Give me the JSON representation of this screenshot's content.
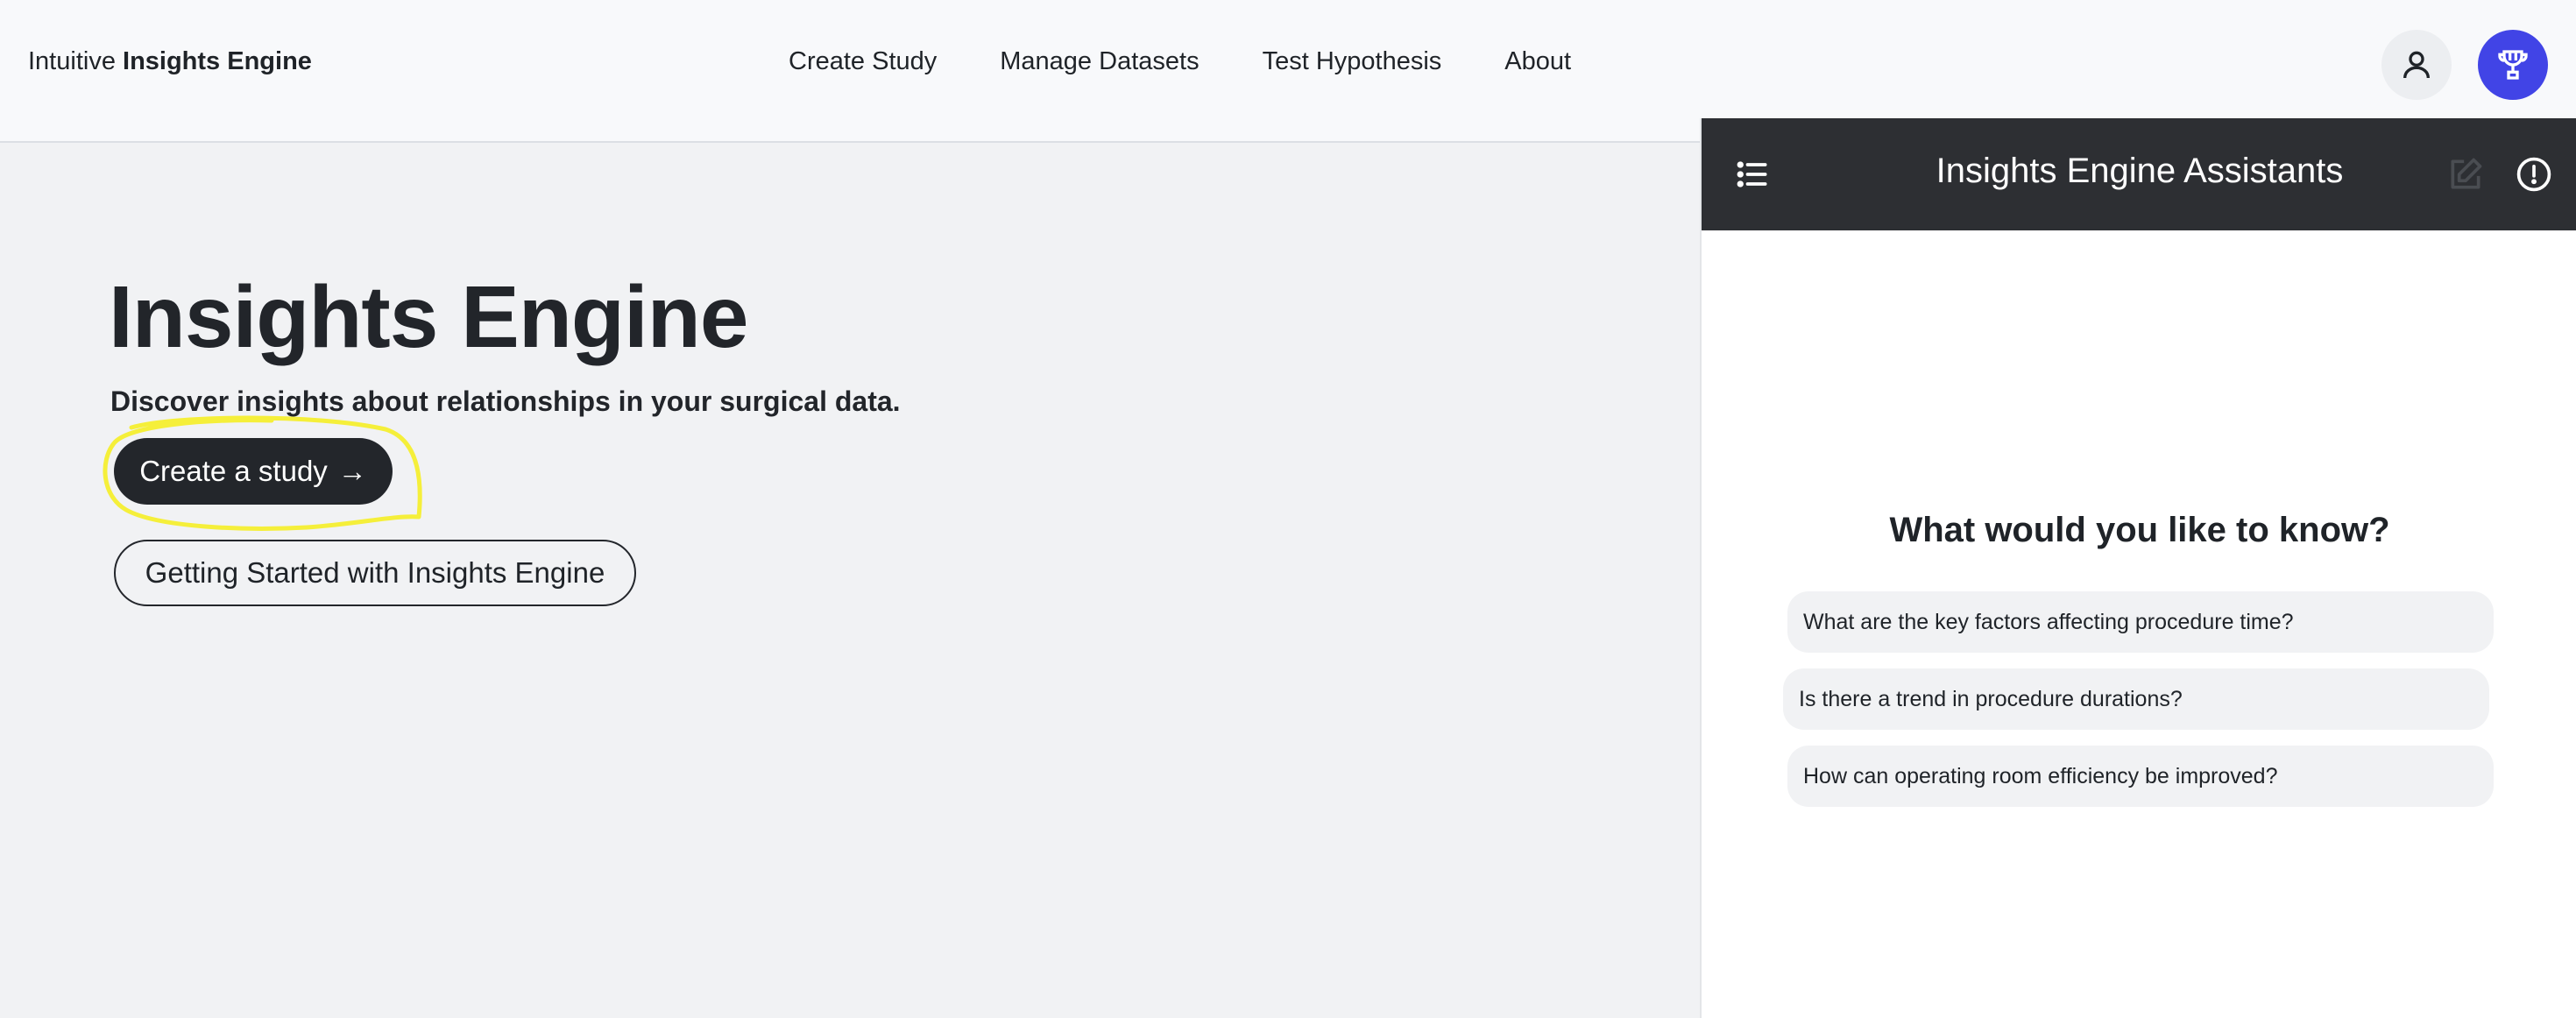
{
  "header": {
    "brand_prefix": "Intuitive",
    "brand_name": "Insights Engine",
    "nav": [
      {
        "label": "Create Study"
      },
      {
        "label": "Manage Datasets"
      },
      {
        "label": "Test Hypothesis"
      },
      {
        "label": "About"
      }
    ],
    "icons": {
      "user": "user-icon",
      "trophy": "trophy-icon"
    },
    "accent_color": "#4144e6"
  },
  "hero": {
    "title": "Insights Engine",
    "subtitle": "Discover insights about relationships in your surgical data.",
    "primary_button": "Create a study",
    "primary_button_arrow": "→",
    "secondary_button": "Getting Started with Insights Engine",
    "highlight_color": "#f5ef3a"
  },
  "assistant": {
    "title": "Insights Engine Assistants",
    "icons": {
      "menu": "list-icon",
      "edit": "edit-icon",
      "info": "info-icon"
    },
    "prompt": "What would you like to know?",
    "suggestions": [
      {
        "text": "What are the key factors affecting procedure time?"
      },
      {
        "text": "Is there a trend in procedure durations?"
      },
      {
        "text": "How can operating room efficiency be improved?"
      }
    ]
  }
}
